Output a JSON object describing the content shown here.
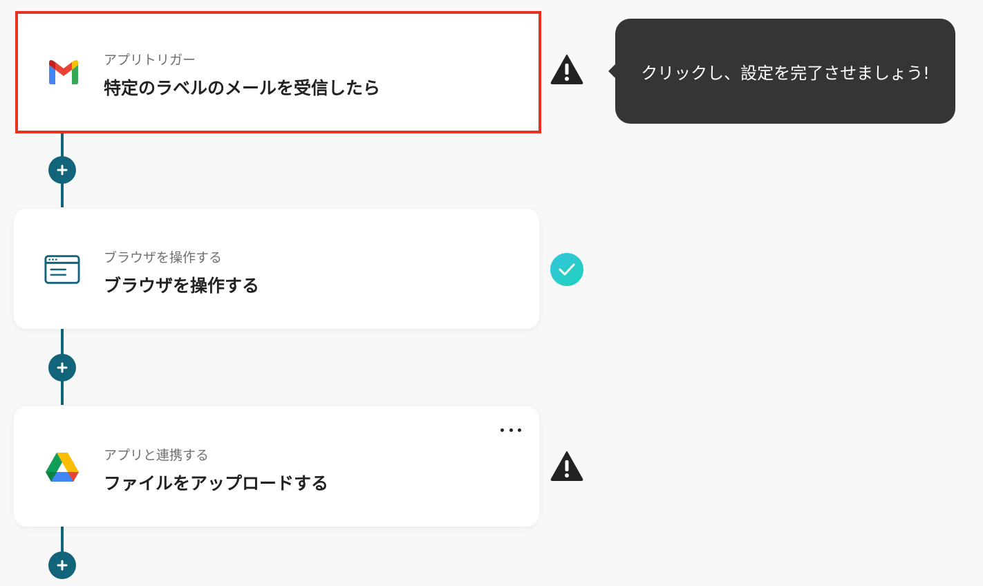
{
  "flow": {
    "steps": [
      {
        "subtitle": "アプリトリガー",
        "title": "特定のラベルのメールを受信したら",
        "icon": "gmail-icon",
        "status": "warning",
        "selected": true
      },
      {
        "subtitle": "ブラウザを操作する",
        "title": "ブラウザを操作する",
        "icon": "browser-window-icon",
        "status": "complete",
        "selected": false
      },
      {
        "subtitle": "アプリと連携する",
        "title": "ファイルをアップロードする",
        "icon": "google-drive-icon",
        "status": "warning",
        "selected": false,
        "has_more_menu": true
      }
    ],
    "add_step_icon": "plus-icon",
    "more_icon": "ellipsis-icon"
  },
  "tooltip": {
    "text": "クリックし、設定を完了させましょう!"
  },
  "colors": {
    "connector": "#12647a",
    "selected_border": "#e8311e",
    "warning": "#222222",
    "success_gradient_start": "#35c6e0",
    "success_gradient_end": "#1fd0b7",
    "tooltip_bg": "#353535",
    "browser_icon": "#12647a"
  }
}
